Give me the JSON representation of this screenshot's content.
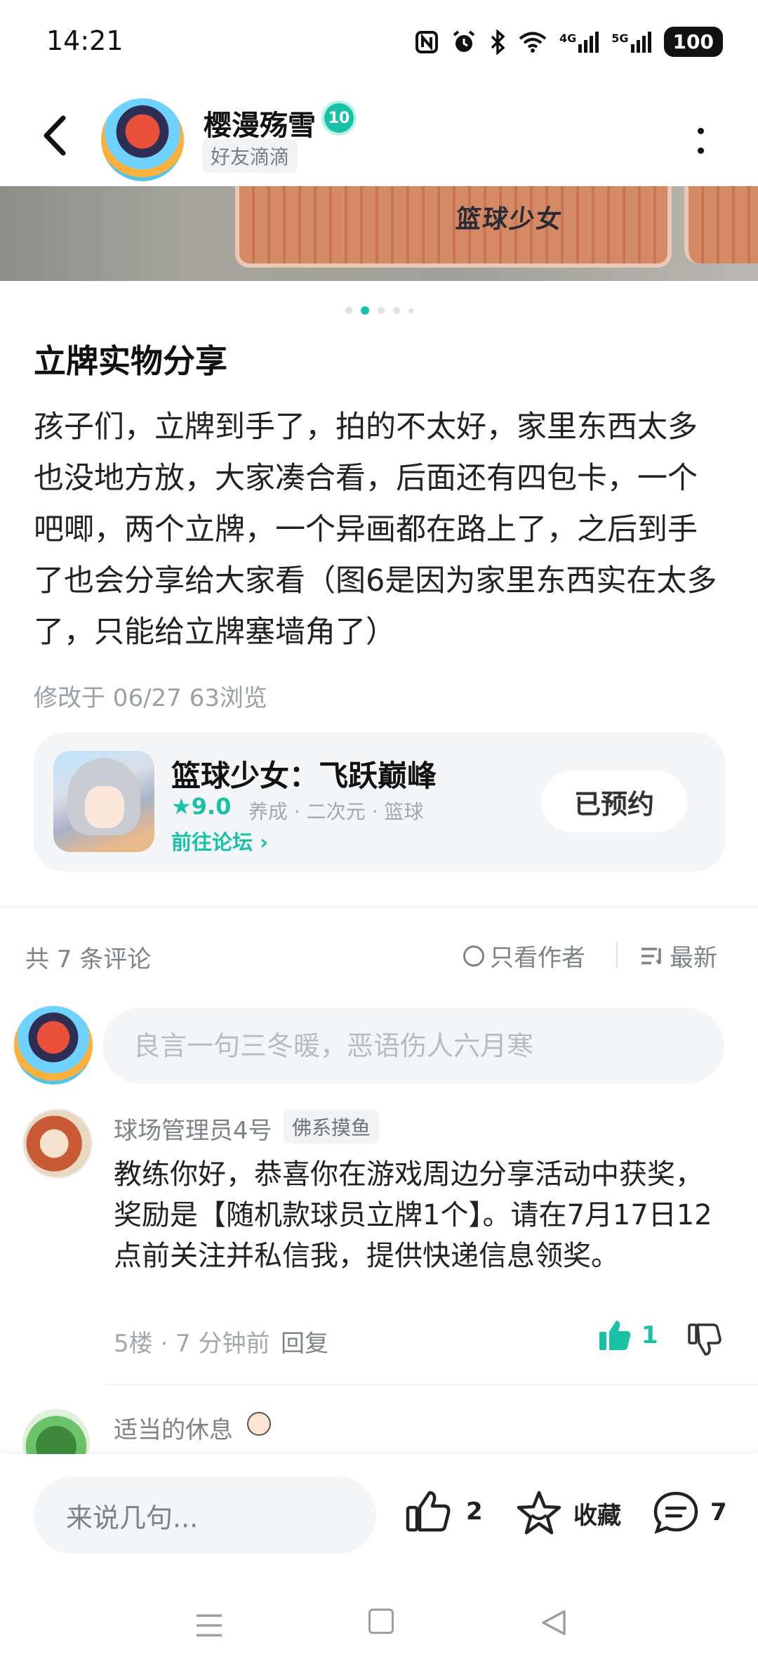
{
  "status_bar": {
    "time": "14:21",
    "icons": [
      "nfc-icon",
      "alarm-icon",
      "bluetooth-icon",
      "wifi-icon",
      "4g-signal-icon",
      "5g-signal-icon"
    ],
    "signal_4g": "4G",
    "signal_5g": "5G",
    "battery": "100"
  },
  "header": {
    "author_name": "樱漫殇雪",
    "author_level": "10",
    "author_tag": "好友滴滴"
  },
  "banner": {
    "board_logo": "篮球少女"
  },
  "pager": {
    "count": 5,
    "active_index": 1
  },
  "post": {
    "title": "立牌实物分享",
    "body": "孩子们，立牌到手了，拍的不太好，家里东西太多也没地方放，大家凑合看，后面还有四包卡，一个吧唧，两个立牌，一个异画都在路上了，之后到手了也会分享给大家看（图6是因为家里东西实在太多了，只能给立牌塞墙角了）",
    "meta": "修改于 06/27  63浏览"
  },
  "game_card": {
    "name": "篮球少女：飞跃巅峰",
    "rating": "9.0",
    "tags": "养成 · 二次元 · 篮球",
    "forum_link": "前往论坛",
    "reserve_label": "已预约"
  },
  "comments_header": {
    "count_text": "共 7 条评论",
    "author_only": "只看作者",
    "sort": "最新"
  },
  "comment_input": {
    "placeholder": "良言一句三冬暖，恶语伤人六月寒"
  },
  "comments": [
    {
      "name": "球场管理员4号",
      "badge": "佛系摸鱼",
      "body": "教练你好，恭喜你在游戏周边分享活动中获奖，奖励是【随机款球员立牌1个】。请在7月17日12点前关注并私信我，提供快递信息领奖。",
      "meta": "5楼 · 7 分钟前",
      "reply": "回复",
      "likes": "1"
    },
    {
      "name": "适当的休息"
    }
  ],
  "bottom_bar": {
    "reply_placeholder": "来说几句...",
    "likes": "2",
    "favorite": "收藏",
    "comments": "7"
  },
  "colors": {
    "accent": "#19c2a6",
    "muted": "#7e8389",
    "card_bg": "#f3f5f7"
  }
}
